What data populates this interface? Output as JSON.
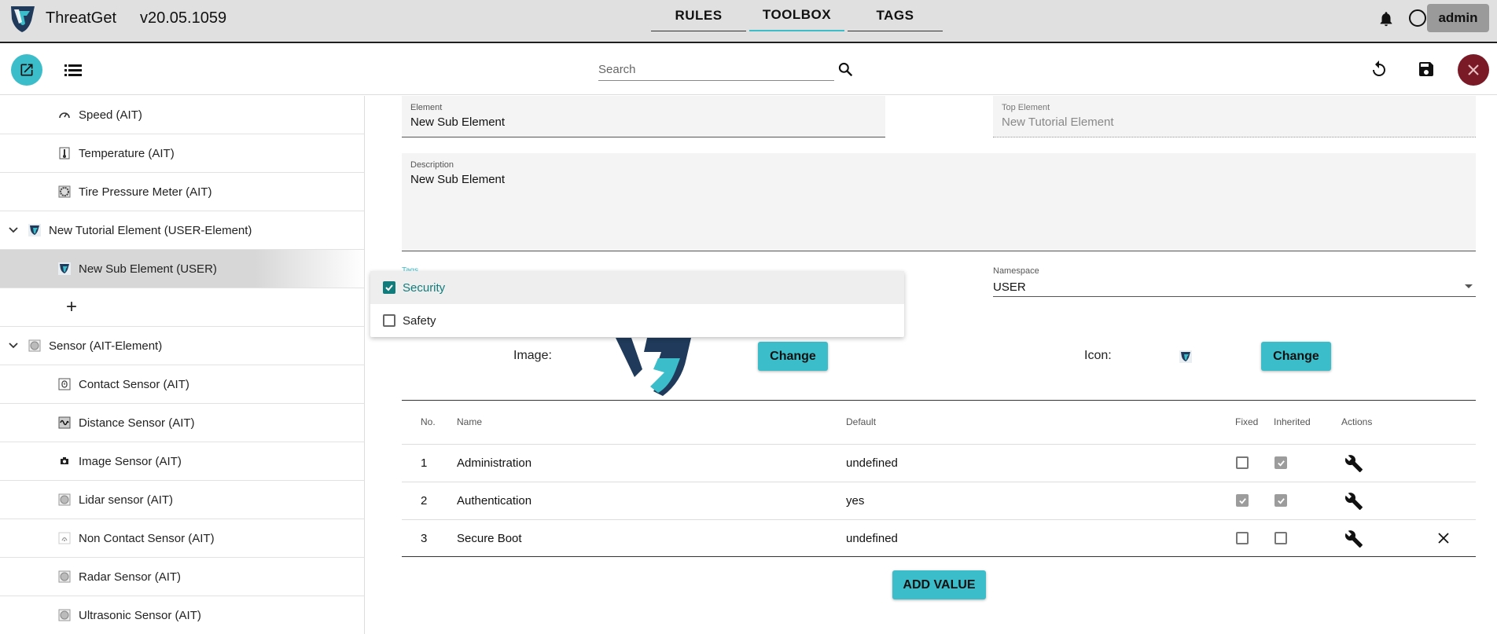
{
  "header": {
    "app_name": "ThreatGet",
    "version": "v20.05.1059",
    "tabs": [
      {
        "label": "RULES",
        "active": false
      },
      {
        "label": "TOOLBOX",
        "active": true
      },
      {
        "label": "TAGS",
        "active": false
      }
    ],
    "user_label": "admin"
  },
  "toolbar": {
    "search_placeholder": "Search",
    "icons": [
      "open-in-new-icon",
      "list-icon",
      "search-icon",
      "undo-icon",
      "save-icon",
      "close-icon"
    ]
  },
  "sidebar": {
    "items": [
      {
        "label": "Speed (AIT)",
        "level": "child",
        "icon": "speedometer-icon"
      },
      {
        "label": "Temperature (AIT)",
        "level": "child",
        "icon": "thermometer-icon"
      },
      {
        "label": "Tire Pressure Meter (AIT)",
        "level": "child",
        "icon": "tire-icon"
      },
      {
        "label": "New Tutorial Element   (USER-Element)",
        "level": "parent",
        "icon": "threatget-logo-icon"
      },
      {
        "label": "New Sub Element (USER)",
        "level": "child",
        "icon": "threatget-logo-icon",
        "selected": true
      },
      {
        "label": "+",
        "level": "add"
      },
      {
        "label": "Sensor   (AIT-Element)",
        "level": "parent",
        "icon": "sensor-icon"
      },
      {
        "label": "Contact Sensor (AIT)",
        "level": "child",
        "icon": "contact-sensor-icon"
      },
      {
        "label": "Distance Sensor (AIT)",
        "level": "child",
        "icon": "distance-sensor-icon"
      },
      {
        "label": "Image Sensor (AIT)",
        "level": "child",
        "icon": "camera-icon"
      },
      {
        "label": "Lidar sensor (AIT)",
        "level": "child",
        "icon": "sensor-icon"
      },
      {
        "label": "Non Contact Sensor (AIT)",
        "level": "child",
        "icon": "non-contact-sensor-icon"
      },
      {
        "label": "Radar Sensor (AIT)",
        "level": "child",
        "icon": "sensor-icon"
      },
      {
        "label": "Ultrasonic Sensor (AIT)",
        "level": "child",
        "icon": "sensor-icon"
      }
    ]
  },
  "form": {
    "element": {
      "label": "Element",
      "value": "New Sub Element"
    },
    "top_element": {
      "label": "Top Element",
      "value": "New Tutorial Element"
    },
    "description": {
      "label": "Description",
      "value": "New Sub Element"
    },
    "tags_label": "Tags",
    "tags_options": [
      {
        "label": "Security",
        "checked": true
      },
      {
        "label": "Safety",
        "checked": false
      }
    ],
    "namespace": {
      "label": "Namespace",
      "value": "USER"
    },
    "image_label": "Image:",
    "icon_label": "Icon:",
    "change_label": "Change"
  },
  "table": {
    "headers": {
      "no": "No.",
      "name": "Name",
      "default": "Default",
      "fixed": "Fixed",
      "inherited": "Inherited",
      "actions": "Actions"
    },
    "rows": [
      {
        "no": "1",
        "name": "Administration",
        "default": "undefined",
        "fixed": false,
        "inherited": true,
        "deletable": false
      },
      {
        "no": "2",
        "name": "Authentication",
        "default": "yes",
        "fixed": true,
        "inherited": true,
        "deletable": false
      },
      {
        "no": "3",
        "name": "Secure Boot",
        "default": "undefined",
        "fixed": false,
        "inherited": false,
        "deletable": true
      }
    ]
  },
  "add_value_label": "ADD VALUE",
  "colors": {
    "accent": "#3bbdca",
    "close": "#7a1a27",
    "check": "#107c7c",
    "logo_dark": "#1f3a5a"
  }
}
